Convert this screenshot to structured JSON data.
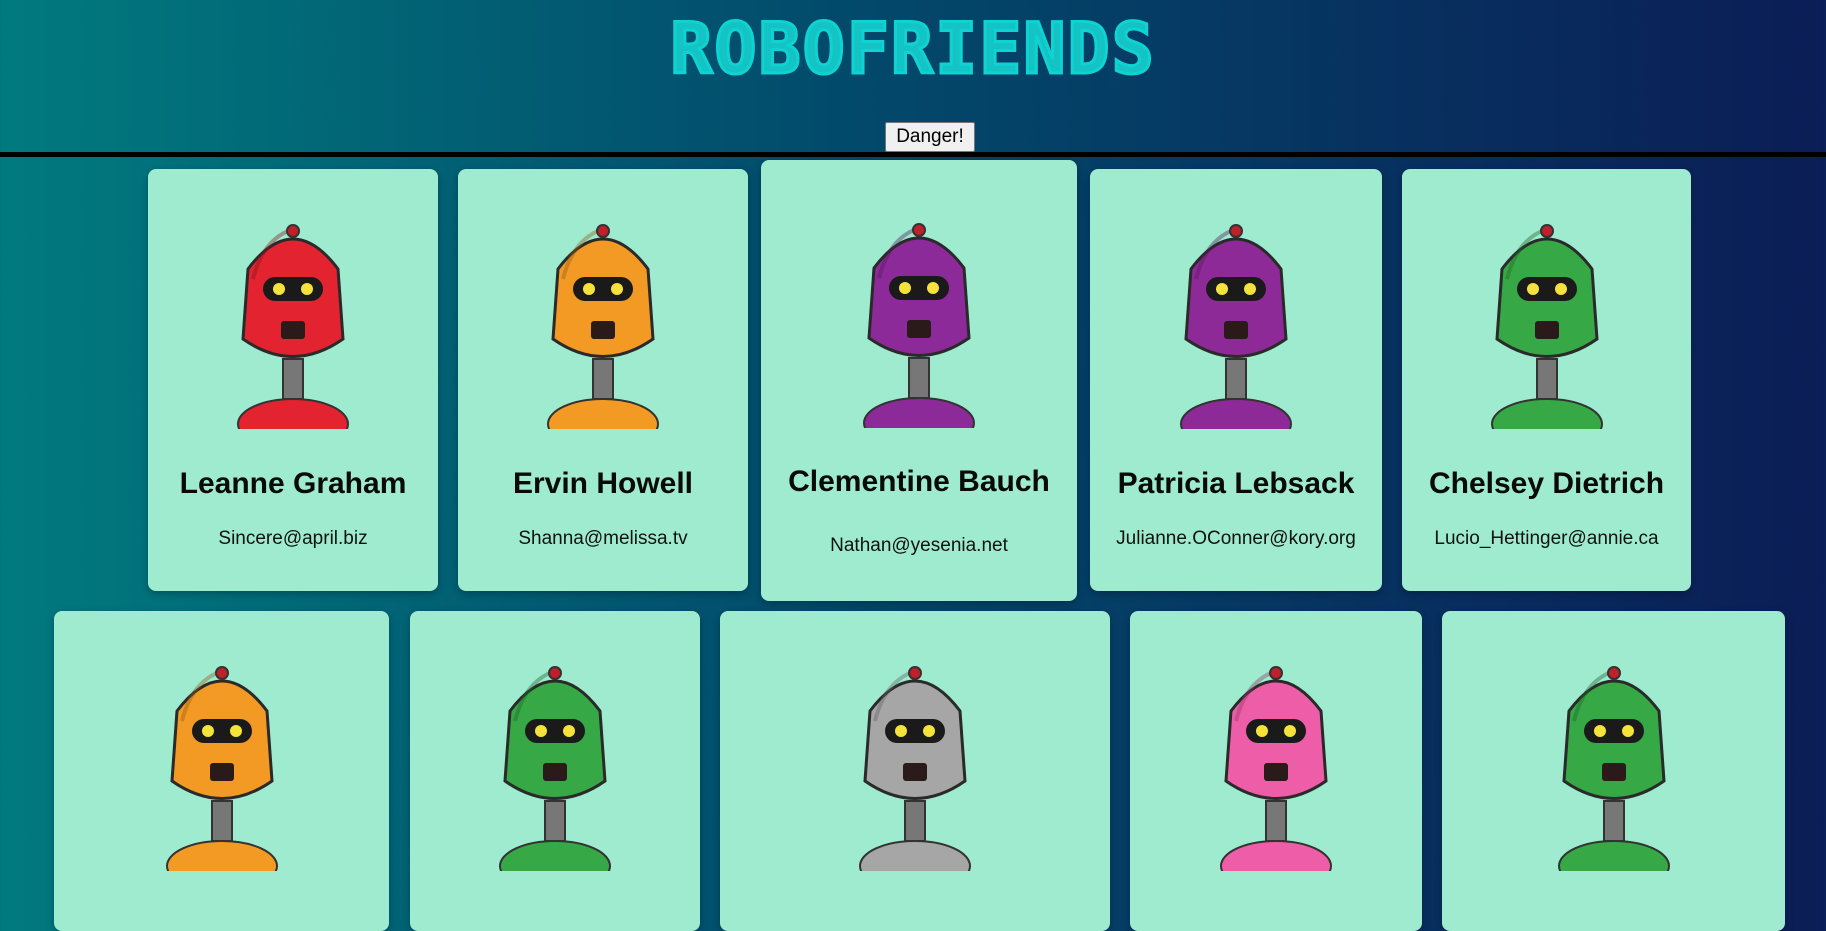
{
  "header": {
    "title": "ROBOFRIENDS",
    "danger_button": "Danger!"
  },
  "robots": [
    {
      "name": "Leanne Graham",
      "email": "Sincere@april.biz",
      "color": "#e32330"
    },
    {
      "name": "Ervin Howell",
      "email": "Shanna@melissa.tv",
      "color": "#f39a24"
    },
    {
      "name": "Clementine Bauch",
      "email": "Nathan@yesenia.net",
      "color": "#8b2a98"
    },
    {
      "name": "Patricia Lebsack",
      "email": "Julianne.OConner@kory.org",
      "color": "#8e2a98"
    },
    {
      "name": "Chelsey Dietrich",
      "email": "Lucio_Hettinger@annie.ca",
      "color": "#36a845"
    },
    {
      "name": "",
      "email": "",
      "color": "#f39a24"
    },
    {
      "name": "",
      "email": "",
      "color": "#36a845"
    },
    {
      "name": "",
      "email": "",
      "color": "#a6a6a6"
    },
    {
      "name": "",
      "email": "",
      "color": "#ee5ea8"
    },
    {
      "name": "",
      "email": "",
      "color": "#36a845"
    }
  ]
}
